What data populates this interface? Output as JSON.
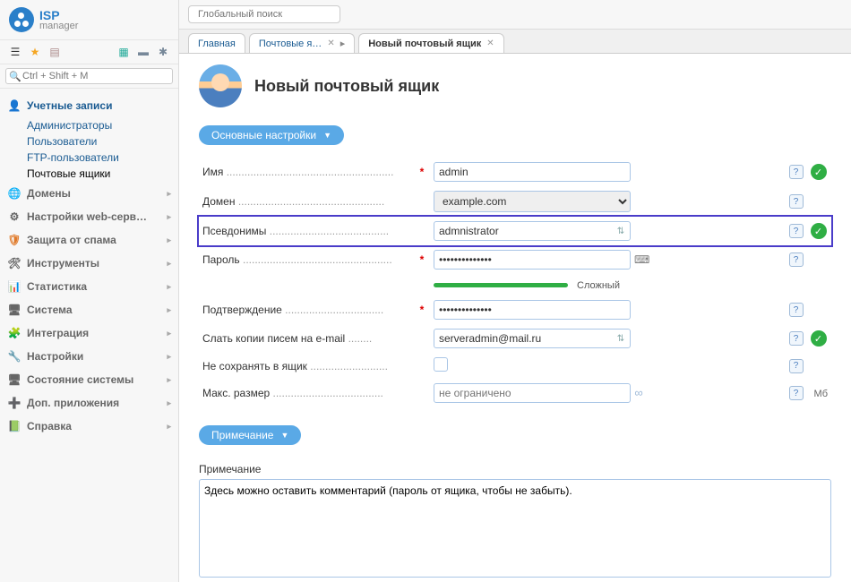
{
  "logo": {
    "brand": "ISP",
    "sub": "manager"
  },
  "global_search_placeholder": "Глобальный поиск",
  "sidebar_search_placeholder": "Ctrl + Shift + M",
  "sidebar": {
    "accounts": {
      "title": "Учетные записи",
      "items": [
        "Администраторы",
        "Пользователи",
        "FTP-пользователи",
        "Почтовые ящики"
      ]
    },
    "groups": [
      "Домены",
      "Настройки web-серв…",
      "Защита от спама",
      "Инструменты",
      "Статистика",
      "Система",
      "Интеграция",
      "Настройки",
      "Состояние системы",
      "Доп. приложения",
      "Справка"
    ]
  },
  "tabs": {
    "list": [
      "Главная",
      "Почтовые я…",
      "Новый почтовый ящик"
    ]
  },
  "page": {
    "title": "Новый почтовый ящик",
    "section_main": "Основные настройки",
    "section_note": "Примечание",
    "note_label": "Примечание",
    "fields": {
      "name_label": "Имя",
      "name_value": "admin",
      "domain_label": "Домен",
      "domain_value": "example.com",
      "aliases_label": "Псевдонимы",
      "aliases_value": "admnistrator",
      "password_label": "Пароль",
      "password_value": "••••••••••••••",
      "password_strength": "Сложный",
      "confirm_label": "Подтверждение",
      "confirm_value": "••••••••••••••",
      "copies_label": "Слать копии писем на e-mail",
      "copies_value": "serveradmin@mail.ru",
      "nosave_label": "Не сохранять в ящик",
      "maxsize_label": "Макс. размер",
      "maxsize_placeholder": "не ограничено",
      "maxsize_unit": "Мб"
    },
    "note_value": "Здесь можно оставить комментарий (пароль от ящика, чтобы не забыть)."
  }
}
